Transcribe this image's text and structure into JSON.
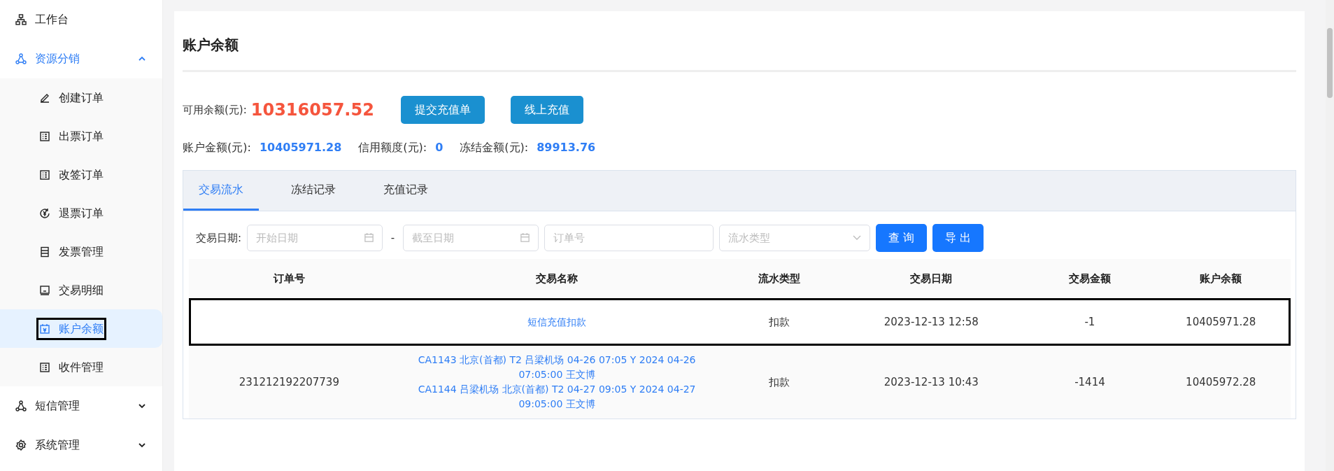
{
  "sidebar": {
    "items": [
      {
        "label": "工作台",
        "selected": false
      },
      {
        "label": "资源分销",
        "selected": false,
        "expanded": true,
        "children": [
          {
            "label": "创建订单",
            "selected": false,
            "highlighted": false
          },
          {
            "label": "出票订单",
            "selected": false,
            "highlighted": false
          },
          {
            "label": "改签订单",
            "selected": false,
            "highlighted": false
          },
          {
            "label": "退票订单",
            "selected": false,
            "highlighted": false
          },
          {
            "label": "发票管理",
            "selected": false,
            "highlighted": false
          },
          {
            "label": "交易明细",
            "selected": false,
            "highlighted": false
          },
          {
            "label": "账户余额",
            "selected": true,
            "highlighted": true
          },
          {
            "label": "收件管理",
            "selected": false,
            "highlighted": false
          }
        ]
      },
      {
        "label": "短信管理",
        "selected": false,
        "expanded": false
      },
      {
        "label": "系统管理",
        "selected": false,
        "expanded": false
      }
    ]
  },
  "page": {
    "title": "账户余额",
    "available": {
      "label": "可用余额(元):",
      "value": "10316057.52"
    },
    "buttons": [
      "提交充值单",
      "线上充值"
    ],
    "stats": [
      {
        "label": "账户金额(元):",
        "value": "10405971.28"
      },
      {
        "label": "信用额度(元):",
        "value": "0"
      },
      {
        "label": "冻结金额(元):",
        "value": "89913.76"
      }
    ]
  },
  "tabs": [
    {
      "label": "交易流水",
      "selected": true
    },
    {
      "label": "冻结记录",
      "selected": false
    },
    {
      "label": "充值记录",
      "selected": false
    }
  ],
  "filters": {
    "date_label": "交易日期:",
    "start_placeholder": "开始日期",
    "separator": "-",
    "end_placeholder": "截至日期",
    "order_placeholder": "订单号",
    "type_placeholder": "流水类型",
    "buttons": [
      "查 询",
      "导 出"
    ]
  },
  "table": {
    "columns": [
      "订单号",
      "交易名称",
      "流水类型",
      "交易日期",
      "交易金额",
      "账户余额"
    ],
    "rows": [
      {
        "order": "",
        "name": [
          "短信充值扣款"
        ],
        "type": "扣款",
        "date": "2023-12-13 12:58",
        "amount": "-1",
        "balance": "10405971.28",
        "highlighted": true
      },
      {
        "order": "231212192207739",
        "name": [
          "CA1143 北京(首都) T2 吕梁机场 04-26 07:05 Y 2024 04-26 07:05:00 王文博",
          "CA1144 吕梁机场 北京(首都) T2 04-27 09:05 Y 2024 04-27 09:05:00 王文博"
        ],
        "type": "扣款",
        "date": "2023-12-13 10:43",
        "amount": "-1414",
        "balance": "10405972.28",
        "highlighted": false
      }
    ]
  }
}
